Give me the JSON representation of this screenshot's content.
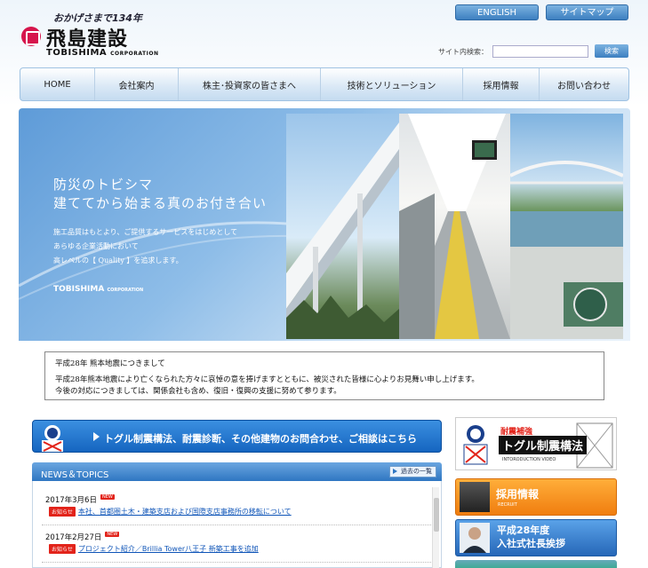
{
  "header": {
    "tagline": "おかげさまで134年",
    "logo_jp": "飛島建設",
    "logo_en": "TOBISHIMA",
    "logo_en_small": "CORPORATION",
    "english_label": "ENGLISH",
    "sitemap_label": "サイトマップ",
    "search_label": "サイト内検索：",
    "search_value": "",
    "search_button": "検索"
  },
  "nav": [
    {
      "label": "HOME"
    },
    {
      "label": "会社案内"
    },
    {
      "label": "株主･投資家の皆さまへ"
    },
    {
      "label": "技術とソリューション"
    },
    {
      "label": "採用情報"
    },
    {
      "label": "お問い合わせ"
    }
  ],
  "hero": {
    "title_line1": "防災のトビシマ",
    "title_line2": "建ててから始まる真のお付き合い",
    "text_line1": "施工品質はもとより、ご提供するサービスをはじめとして",
    "text_line2": "あらゆる企業活動において",
    "text_line3": "高レベルの【 Quality 】を追求します。",
    "logo": "TOBISHIMA",
    "logo_small": "CORPORATION"
  },
  "announcement": {
    "title": "平成28年 熊本地震につきまして",
    "line1": "平成28年熊本地震により亡くなられた方々に哀悼の意を捧げますとともに、被災された皆様に心よりお見舞い申し上げます。",
    "line2": "今後の対応につきましては、関係会社も含め、復旧・復興の支援に努めて参ります。"
  },
  "banner": {
    "text": "トグル制震構法、耐震診断、その他建物のお問合わせ、ご相談はこちら"
  },
  "news": {
    "title": "NEWS＆TOPICS",
    "more_label": "過去の一覧",
    "items": [
      {
        "date": "2017年3月6日",
        "badge": "NEW",
        "category": "お知らせ",
        "text": "本社、首都圏土木・建築支店および国際支店事務所の移転について"
      },
      {
        "date": "2017年2月27日",
        "badge": "NEW",
        "category": "お知らせ",
        "text": "プロジェクト紹介／Brillia Tower八王子 新築工事を追加"
      }
    ]
  },
  "side": {
    "toggle_sub": "耐震補強",
    "toggle_main": "トグル制震構法",
    "toggle_video": "INTORODUCTION VIDEO",
    "recruit_title": "採用情報",
    "recruit_sub": "RECRUIT",
    "president_line1": "平成28年度",
    "president_line2": "入社式社長挨拶"
  },
  "colors": {
    "brand_red": "#d6154c",
    "link_blue": "#0f55b8",
    "accent_orange": "#f07d0f",
    "nav_blue": "#2f76c2"
  }
}
